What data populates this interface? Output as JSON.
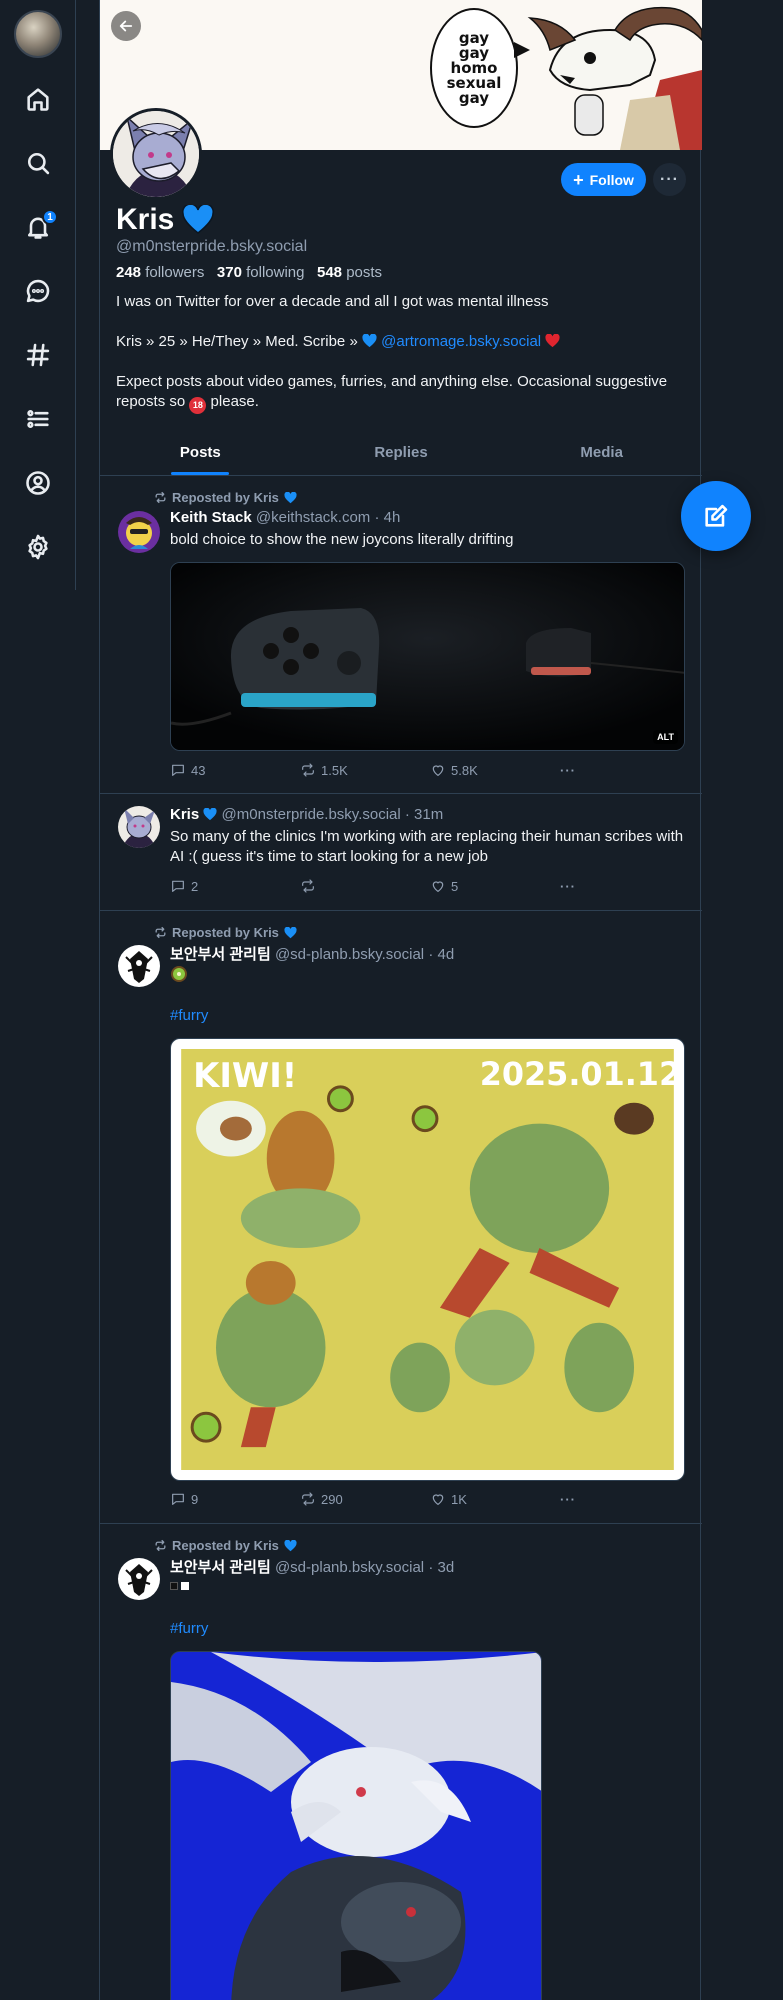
{
  "nav": {
    "items": [
      "home",
      "search",
      "notifications",
      "chat",
      "feeds",
      "lists",
      "profile",
      "settings"
    ],
    "notification_badge": "1"
  },
  "banner": {
    "speech_lines": [
      "gay",
      "gay",
      "homo",
      "sexual",
      "gay"
    ]
  },
  "profile": {
    "display_name": "Kris",
    "handle": "@m0nsterpride.bsky.social",
    "followers_count": "248",
    "followers_label": "followers",
    "following_count": "370",
    "following_label": "following",
    "posts_count": "548",
    "posts_label": "posts",
    "bio_line1": "I was on Twitter for over a decade and all I got was mental illness",
    "bio_line2_prefix": "Kris » 25 » He/They » Med. Scribe »",
    "bio_line2_link": "@artromage.bsky.social",
    "bio_line3_a": "Expect posts about video games, furries, and anything else. Occasional suggestive reposts so",
    "bio_line3_b": "please.",
    "follow_label": "Follow",
    "more_label": "···",
    "icon18_label": "18"
  },
  "tabs": [
    "Posts",
    "Replies",
    "Media"
  ],
  "feed": [
    {
      "repost_label": "Reposted by Kris",
      "author": "Keith Stack",
      "handle": "@keithstack.com",
      "time": "· 4h",
      "text": "bold choice to show the new joycons literally drifting",
      "alt": "ALT",
      "replies": "43",
      "reposts": "1.5K",
      "likes": "5.8K"
    },
    {
      "author": "Kris",
      "handle": "@m0nsterpride.bsky.social",
      "time": "· 31m",
      "text": "So many of the clinics I'm working with are replacing their human scribes with AI :( guess it's time to start looking for a new job",
      "replies": "2",
      "reposts": "",
      "likes": "5"
    },
    {
      "repost_label": "Reposted by Kris",
      "author": "보안부서 관리팀",
      "handle": "@sd-planb.bsky.social",
      "time": "· 4d",
      "hashtag": "#furry",
      "art_title": "KIWI!",
      "art_date": "2025.01.12",
      "replies": "9",
      "reposts": "290",
      "likes": "1K"
    },
    {
      "repost_label": "Reposted by Kris",
      "author": "보안부서 관리팀",
      "handle": "@sd-planb.bsky.social",
      "time": "· 3d",
      "hashtag": "#furry"
    }
  ],
  "colors": {
    "background": "#161e27",
    "accent": "#1083fe",
    "link": "#208bfe",
    "muted": "#8f9db0",
    "border": "#2e4052"
  }
}
